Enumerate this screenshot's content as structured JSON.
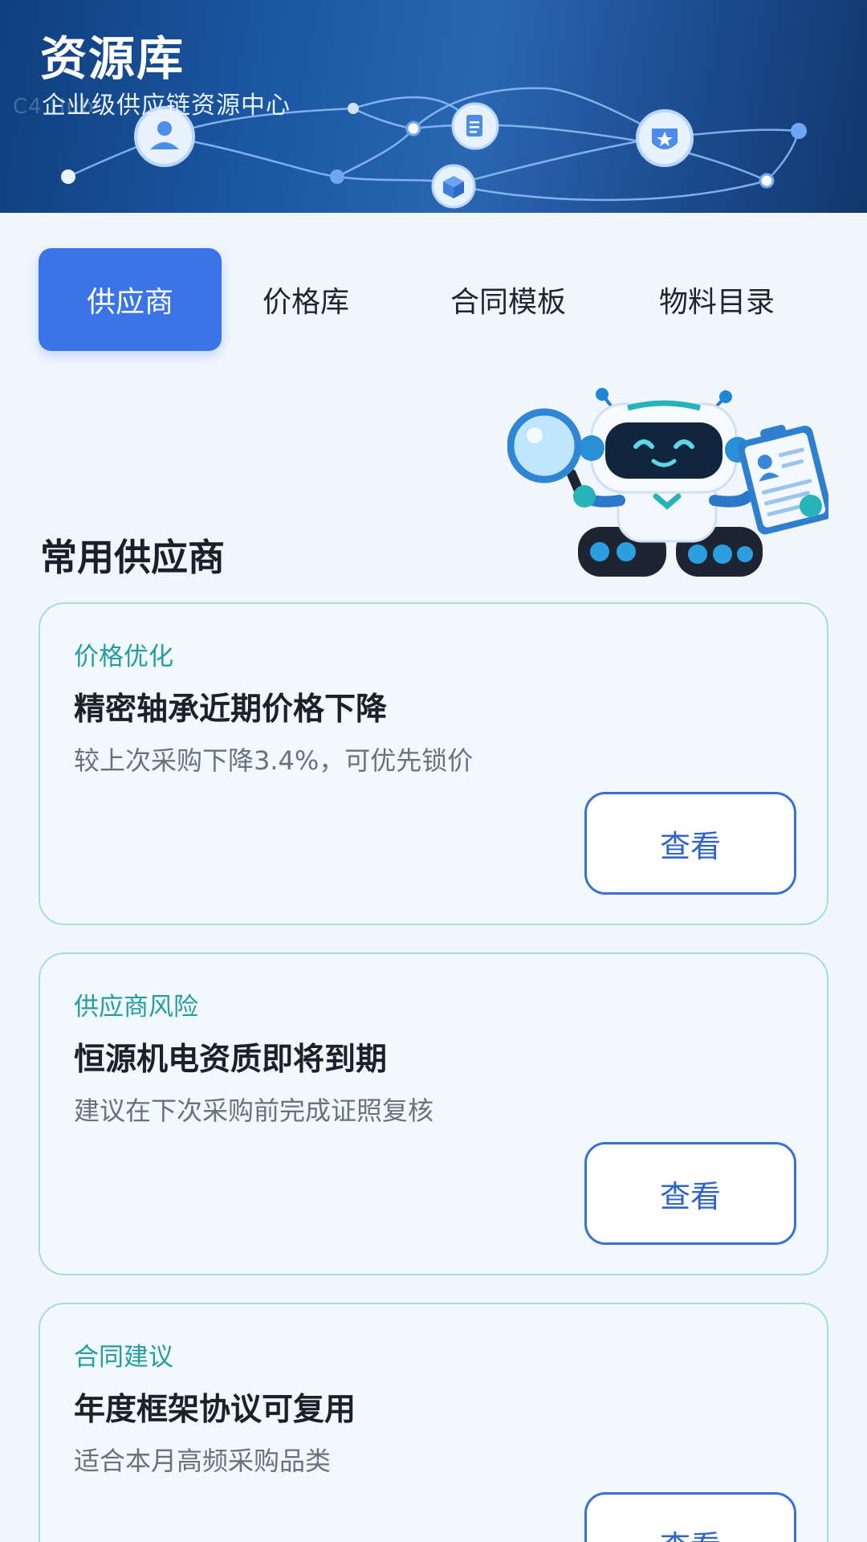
{
  "header": {
    "title": "资源库",
    "subtitle": "企业级供应链资源中心",
    "watermark": "C4 Hub"
  },
  "tabs": [
    {
      "label": "供应商",
      "active": true
    },
    {
      "label": "价格库",
      "active": false
    },
    {
      "label": "合同模板",
      "active": false
    },
    {
      "label": "物料目录",
      "active": false
    }
  ],
  "section": {
    "title": "常用供应商"
  },
  "cards": [
    {
      "tag": "价格优化",
      "title": "精密轴承近期价格下降",
      "description": "较上次采购下降3.4%，可优先锁价",
      "button": "查看"
    },
    {
      "tag": "供应商风险",
      "title": "恒源机电资质即将到期",
      "description": "建议在下次采购前完成证照复核",
      "button": "查看"
    },
    {
      "tag": "合同建议",
      "title": "年度框架协议可复用",
      "description": "适合本月高频采购品类",
      "button": "查看"
    }
  ],
  "colors": {
    "primary": "#3b74e6",
    "tag": "#239da3",
    "card_border": "#a7dcdf",
    "header_dark": "#0f3f7e"
  },
  "icons": [
    "user-icon",
    "document-icon",
    "box-icon",
    "badge-icon",
    "robot-illustration",
    "magnifier-icon",
    "clipboard-icon"
  ]
}
